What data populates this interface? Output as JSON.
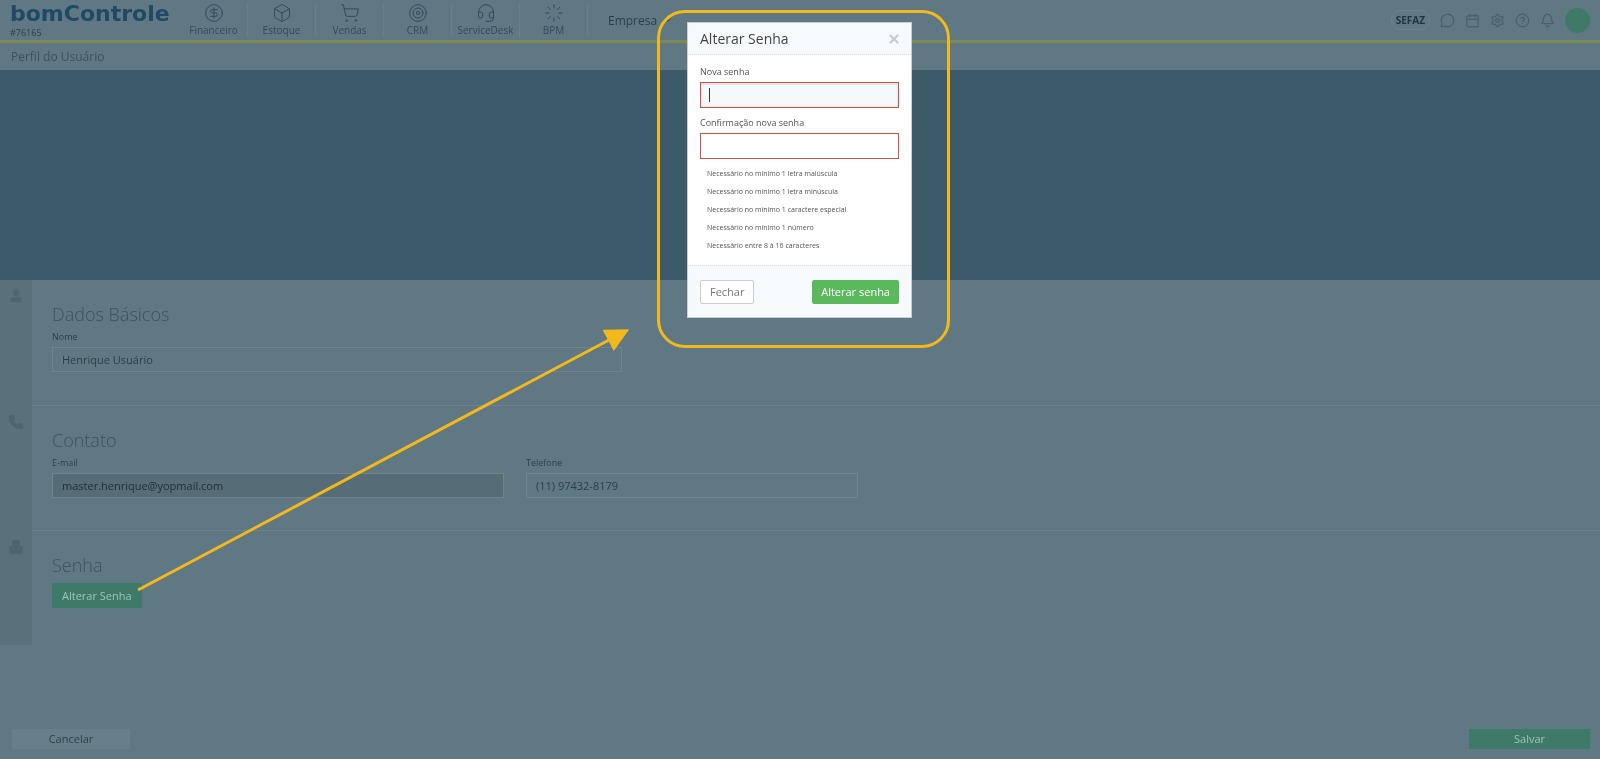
{
  "header": {
    "logo": "bomControle",
    "account_id": "#76165",
    "nav": [
      {
        "label": "Financeiro",
        "kind": "dollar"
      },
      {
        "label": "Estoque",
        "kind": "box"
      },
      {
        "label": "Vendas",
        "kind": "cart"
      },
      {
        "label": "CRM",
        "kind": "target"
      },
      {
        "label": "ServiceDesk",
        "kind": "headset"
      },
      {
        "label": "BPM",
        "kind": "cycle"
      }
    ],
    "company_menu": "Empresa",
    "sefaz": "SEFAZ"
  },
  "page_title": "Perfil do Usuário",
  "sections": [
    {
      "title": "Dados Básicos",
      "kind": "user",
      "fields": [
        {
          "label": "Nome",
          "value": "Henrique Usuário",
          "disabled": false
        }
      ]
    },
    {
      "title": "Contato",
      "kind": "phone",
      "fields": [
        {
          "label": "E-mail",
          "value": "master.henrique@yopmail.com",
          "disabled": true
        },
        {
          "label": "Telefone",
          "value": "(11) 97432-8179",
          "disabled": false
        }
      ]
    },
    {
      "title": "Senha",
      "kind": "lock",
      "button": "Alterar Senha"
    }
  ],
  "footer": {
    "cancel": "Cancelar",
    "save": "Salvar"
  },
  "modal": {
    "title": "Alterar Senha",
    "fields": [
      {
        "label": "Nova senha",
        "invalid": true,
        "focused": true
      },
      {
        "label": "Confirmação nova senha",
        "invalid": true,
        "focused": false
      }
    ],
    "requirements": [
      "Necessário no mínimo 1 letra maiúscula",
      "Necessário no mínimo 1 letra minúscula",
      "Necessário no mínimo 1 caractere especial",
      "Necessário no mínimo 1 número",
      "Necessário entre 8 à 16 caracteres"
    ],
    "close": "Fechar",
    "submit": "Alterar senha"
  }
}
